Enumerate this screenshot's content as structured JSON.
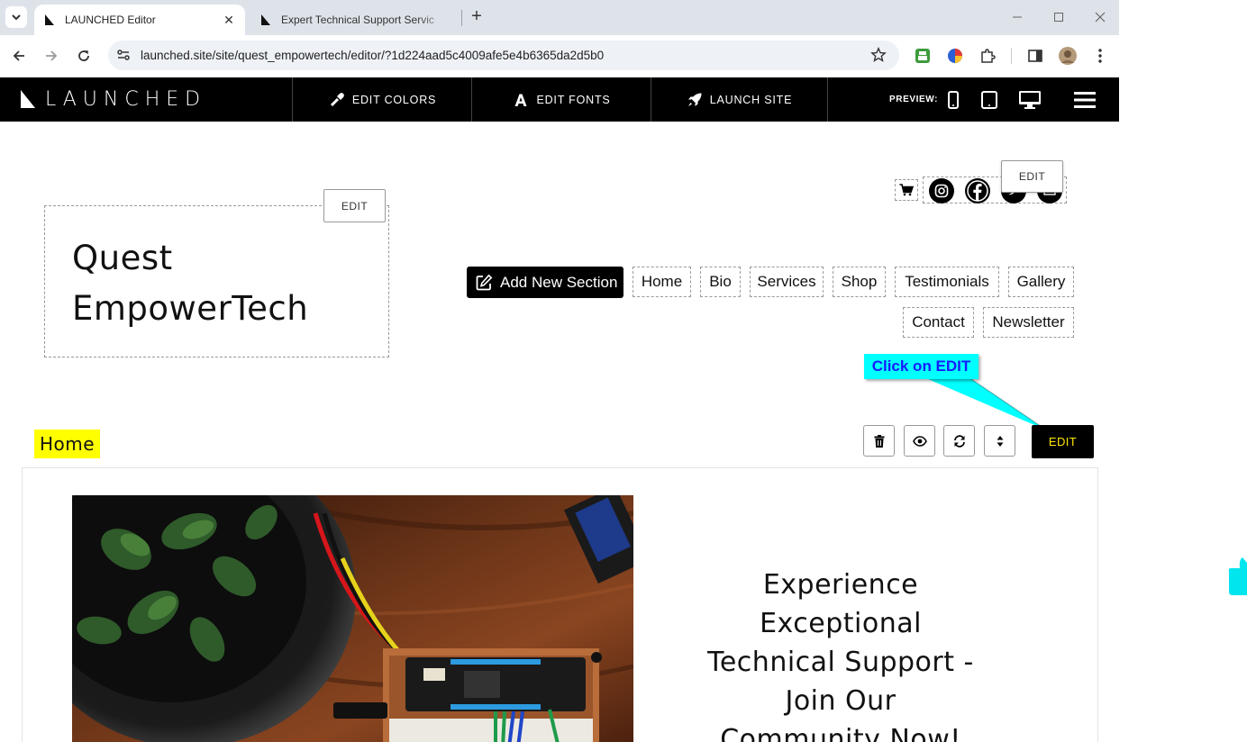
{
  "browser": {
    "tabs": [
      {
        "title": "LAUNCHED Editor",
        "active": true
      },
      {
        "title": "Expert Technical Support Servic",
        "active": false
      }
    ],
    "url": "launched.site/site/quest_empowertech/editor/?1d224aad5c4009afe5e4b6365da2d5b0"
  },
  "editor": {
    "logo": "LAUNCHED",
    "edit_colors": "EDIT COLORS",
    "edit_fonts": "EDIT FONTS",
    "launch_site": "LAUNCH SITE",
    "preview_label": "PREVIEW:"
  },
  "site": {
    "brand_line1": "Quest",
    "brand_line2": "EmpowerTech",
    "edit_label": "EDIT",
    "add_section": "Add New Section",
    "nav": [
      "Home",
      "Bio",
      "Services",
      "Shop",
      "Testimonials",
      "Gallery",
      "Contact",
      "Newsletter"
    ],
    "callout": "Click on EDIT",
    "section_name": "Home",
    "hero_title_lines": [
      "Experience",
      "Exceptional",
      "Technical Support -",
      "Join Our",
      "Community Now!"
    ]
  },
  "colors": {
    "editor_bar": "#000000",
    "callout_bg": "#00ffff",
    "callout_text": "#1a1aff",
    "section_highlight": "#ffff00",
    "edit_text": "#ffe700"
  }
}
